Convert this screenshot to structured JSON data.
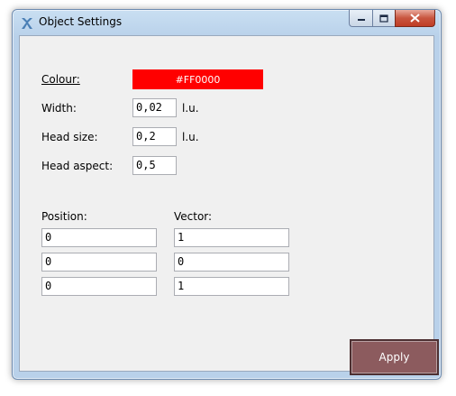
{
  "window": {
    "title": "Object Settings"
  },
  "form": {
    "colour_label": "Colour:",
    "colour_value": "#FF0000",
    "colour_hex": "#FF0000",
    "width_label": "Width:",
    "width_value": "0,02",
    "width_unit": "l.u.",
    "head_size_label": "Head size:",
    "head_size_value": "0,2",
    "head_size_unit": "l.u.",
    "head_aspect_label": "Head aspect:",
    "head_aspect_value": "0,5"
  },
  "position": {
    "label": "Position:",
    "values": [
      "0",
      "0",
      "0"
    ]
  },
  "vector": {
    "label": "Vector:",
    "values": [
      "1",
      "0",
      "1"
    ]
  },
  "apply_label": "Apply",
  "icons": {
    "app": "app-logo-icon",
    "minimize": "minimize-icon",
    "maximize": "maximize-icon",
    "close": "close-icon"
  }
}
